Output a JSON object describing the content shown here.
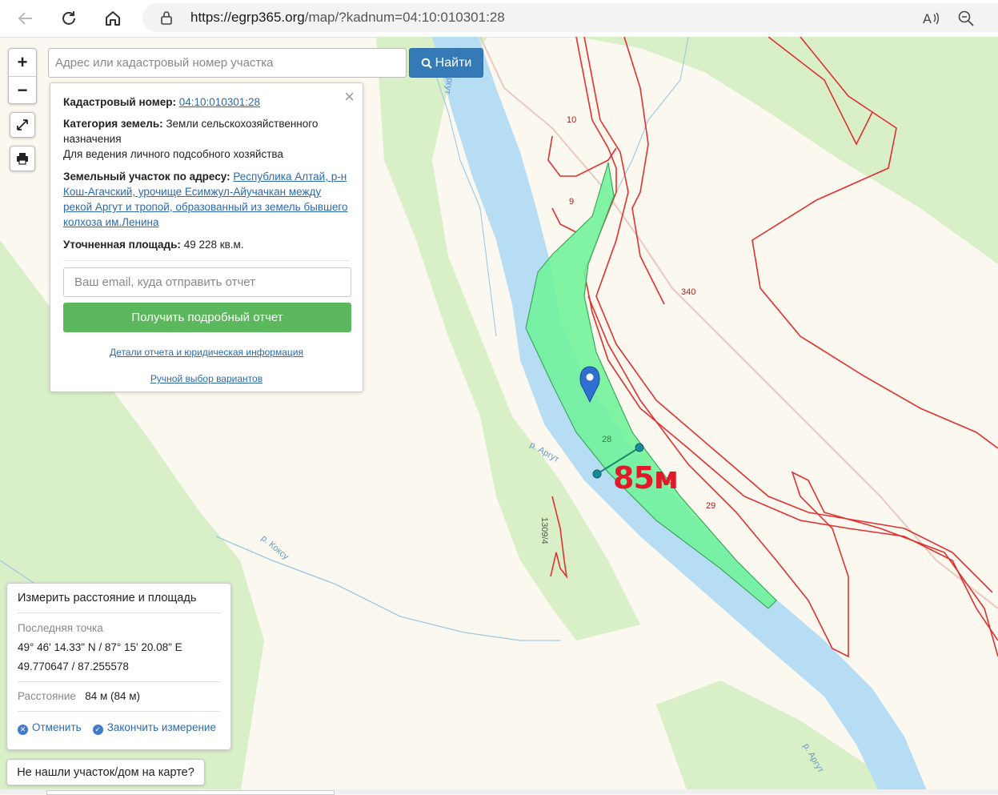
{
  "browser": {
    "url_domain": "https://egrp365.org",
    "url_path": "/map/?kadnum=04:10:010301:28"
  },
  "search": {
    "placeholder": "Адрес или кадастровый номер участка",
    "button_label": "Найти"
  },
  "zoom": {
    "in": "+",
    "out": "−"
  },
  "info": {
    "cadastral_label": "Кадастровый номер:",
    "cadastral_value": "04:10:010301:28",
    "category_label": "Категория земель:",
    "category_value": "Земли сельскохозяйственного назначения",
    "usage": "Для ведения личного подсобного хозяйства",
    "address_label": "Земельный участок по адресу:",
    "address_value": "Республика Алтай, р-н Кош-Агачский, урочище Есимжул-Айучачкан между рекой Аргут и тропой, образованный из земель бывшего колхоза им.Ленина",
    "area_label": "Уточненная площадь:",
    "area_value": "49 228 кв.м.",
    "email_placeholder": "Ваш email, куда отправить отчет",
    "report_button": "Получить подробный отчет",
    "details_link": "Детали отчета и юридическая информация",
    "manual_link": "Ручной выбор вариантов"
  },
  "measure": {
    "title": "Измерить расстояние и площадь",
    "last_point_label": "Последняя точка",
    "dms": "49° 46' 14.33\" N / 87° 15' 20.08\" E",
    "decimal": "49.770647 / 87.255578",
    "distance_label": "Расстояние",
    "distance_value": "84 м (84 м)",
    "cancel": "Отменить",
    "finish": "Закончить измерение"
  },
  "not_found": "Не нашли участок/дом на карте?",
  "map": {
    "annotation": "85м",
    "plot_labels": [
      "10",
      "9",
      "340",
      "28",
      "29",
      "1309/4"
    ],
    "river_labels": [
      "р. Аргут",
      "р. Коксу",
      "р. Аргут",
      "Аргут"
    ]
  },
  "colors": {
    "river": "#b7ddf4",
    "forest": "#d8efc8",
    "parcel": "#6ff39a",
    "boundary": "#e03030",
    "button_blue": "#337ab7",
    "button_green": "#5cb85c"
  }
}
